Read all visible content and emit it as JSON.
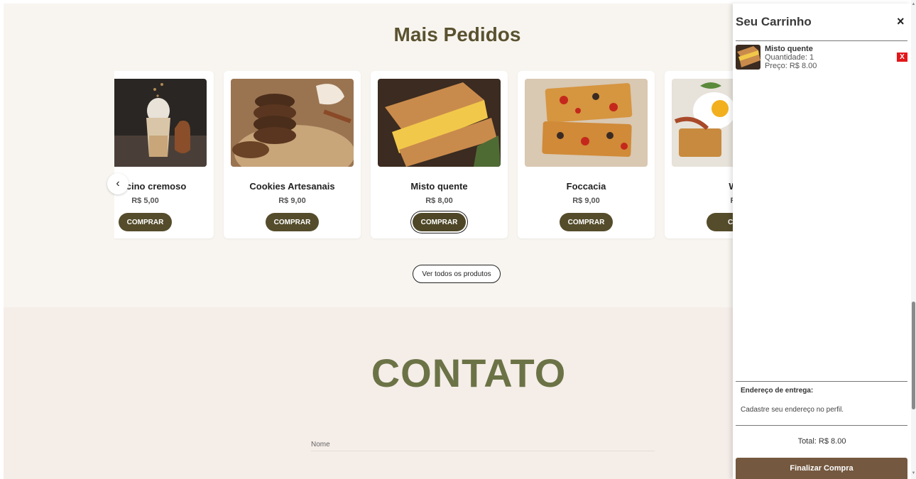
{
  "featured": {
    "title": "Mais Pedidos",
    "prev_glyph": "‹",
    "products": [
      {
        "name": "ppuccino cremoso",
        "price": "R$ 5,00",
        "buy_label": "COMPRAR"
      },
      {
        "name": "Cookies Artesanais",
        "price": "R$ 9,00",
        "buy_label": "COMPRAR"
      },
      {
        "name": "Misto quente",
        "price": "R$ 8,00",
        "buy_label": "COMPRAR"
      },
      {
        "name": "Foccacia",
        "price": "R$ 9,00",
        "buy_label": "COMPRAR"
      },
      {
        "name": "W",
        "price": "R",
        "buy_label": "CO"
      }
    ],
    "view_all_label": "Ver todos os produtos"
  },
  "contact": {
    "title": "CONTATO",
    "name_label": "Nome"
  },
  "cart": {
    "title": "Seu Carrinho",
    "close_glyph": "×",
    "items": [
      {
        "name": "Misto quente",
        "quantity": "Quantidade: 1",
        "price": "Preço: R$ 8.00",
        "remove_label": "X"
      }
    ],
    "address_label": "Endereço de entrega:",
    "address_text": "Cadastre seu endereço no perfil.",
    "total": "Total: R$ 8.00",
    "checkout_label": "Finalizar Compra"
  },
  "colors": {
    "brand_olive": "#554c2b",
    "heading_olive": "#5a5230",
    "contact_green": "#6b7346",
    "checkout_brown": "#74583f",
    "remove_red": "#e3171b"
  }
}
